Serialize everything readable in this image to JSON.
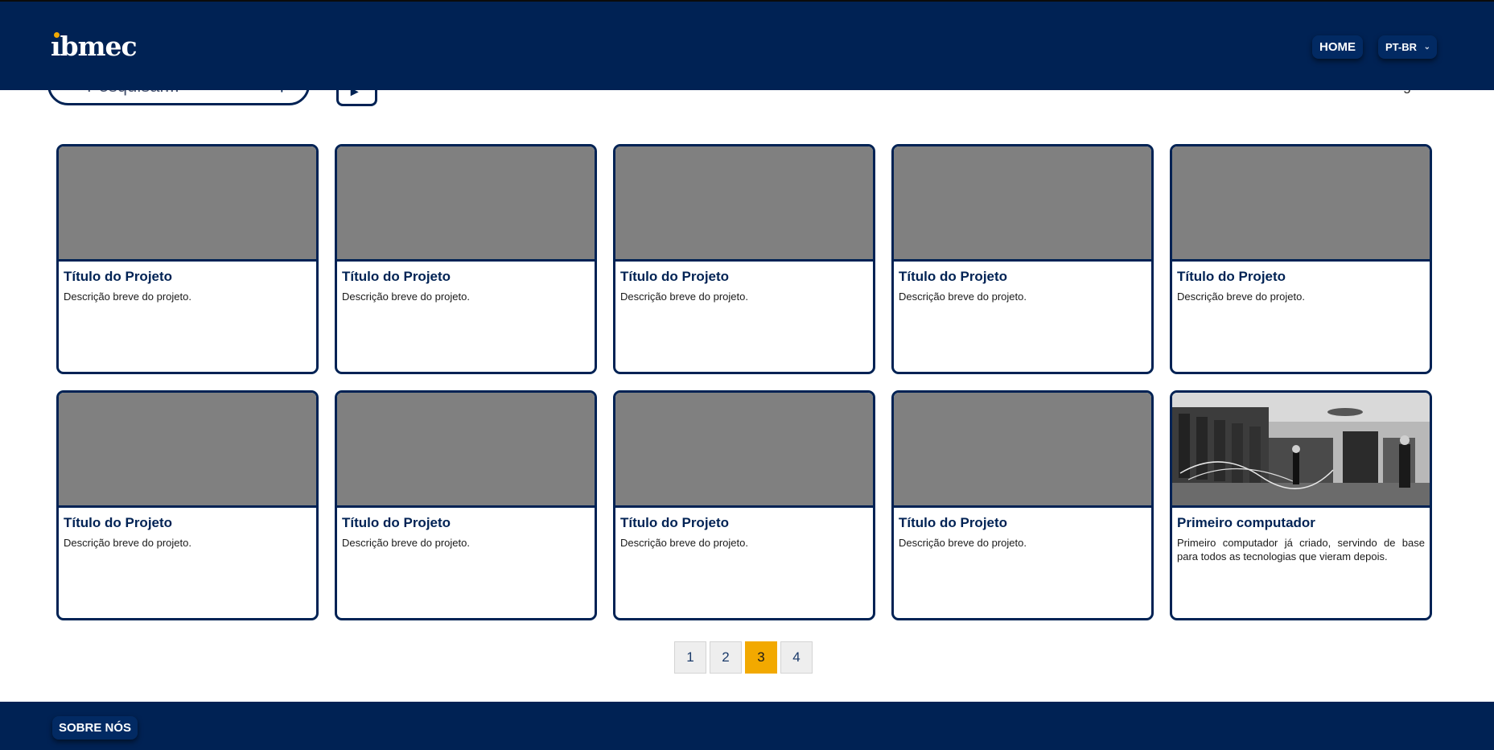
{
  "header": {
    "logo_text": "ıbmec",
    "nav": {
      "home_label": "HOME",
      "language_label": "PT-BR"
    },
    "colors": {
      "brand": "#002254",
      "accent": "#f2a900"
    }
  },
  "toolbar": {
    "search_placeholder": "Pesquisar...",
    "search_icon": "search-icon",
    "filter_icon": "filter-icon"
  },
  "cards": [
    {
      "title": "Título do Projeto",
      "description": "Descrição breve do projeto."
    },
    {
      "title": "Título do Projeto",
      "description": "Descrição breve do projeto."
    },
    {
      "title": "Título do Projeto",
      "description": "Descrição breve do projeto."
    },
    {
      "title": "Título do Projeto",
      "description": "Descrição breve do projeto."
    },
    {
      "title": "Título do Projeto",
      "description": "Descrição breve do projeto."
    },
    {
      "title": "Título do Projeto",
      "description": "Descrição breve do projeto."
    },
    {
      "title": "Título do Projeto",
      "description": "Descrição breve do projeto."
    },
    {
      "title": "Título do Projeto",
      "description": "Descrição breve do projeto."
    },
    {
      "title": "Título do Projeto",
      "description": "Descrição breve do projeto."
    },
    {
      "title": "Primeiro computador",
      "description": "Primeiro computador já criado, servindo de base para todos as tecnologias que vieram depois."
    }
  ],
  "pagination": {
    "pages": [
      "1",
      "2",
      "3",
      "4"
    ],
    "current": "3"
  },
  "footer": {
    "about_label": "SOBRE NÓS"
  }
}
